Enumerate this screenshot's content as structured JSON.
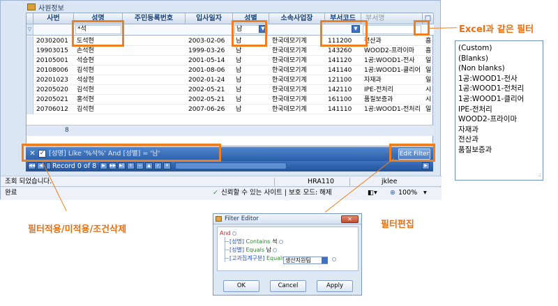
{
  "window": {
    "title": "사원정보",
    "columns": [
      "사번",
      "성명",
      "주민등록번호",
      "입사일자",
      "성별",
      "소속사업장",
      "부서코드",
      "부서명",
      "□"
    ],
    "filter_row": {
      "name_filter": "*석",
      "gender_filter": "남"
    },
    "rows": [
      {
        "id": "20302001",
        "name": "도석현",
        "join": "2003-02-06",
        "gender": "남",
        "site": "한국데모기계",
        "dept_code": "111200",
        "dept_name": "전산과",
        "extra": "흠"
      },
      {
        "id": "19903015",
        "name": "손석현",
        "join": "1999-03-26",
        "gender": "남",
        "site": "한국데모기계",
        "dept_code": "143260",
        "dept_name": "WOOD2-프라이마",
        "extra": "흠"
      },
      {
        "id": "20105001",
        "name": "석승현",
        "join": "2001-05-14",
        "gender": "남",
        "site": "한국데모기계",
        "dept_code": "141120",
        "dept_name": "1공:WOOD1-전사",
        "extra": "일"
      },
      {
        "id": "20108006",
        "name": "김석현",
        "join": "2001-08-06",
        "gender": "남",
        "site": "한국데모기계",
        "dept_code": "141140",
        "dept_name": "1공:WOOD1-클리어",
        "extra": "일"
      },
      {
        "id": "20201023",
        "name": "석상현",
        "join": "2002-01-24",
        "gender": "남",
        "site": "한국데모기계",
        "dept_code": "121100",
        "dept_name": "자재과",
        "extra": "일"
      },
      {
        "id": "20205020",
        "name": "김석현",
        "join": "2002-05-21",
        "gender": "남",
        "site": "한국데모기계",
        "dept_code": "142110",
        "dept_name": "IPE-전처리",
        "extra": "시"
      },
      {
        "id": "20205021",
        "name": "홍석현",
        "join": "2002-05-21",
        "gender": "남",
        "site": "한국데모기계",
        "dept_code": "161100",
        "dept_name": "품질보증과",
        "extra": "시"
      },
      {
        "id": "20706012",
        "name": "김석현",
        "join": "2007-06-26",
        "gender": "남",
        "site": "한국데모기계",
        "dept_code": "141110",
        "dept_name": "1공:WOOD1-전처리",
        "extra": "일"
      }
    ],
    "record_count": "8",
    "filter_text": "[성명] Like '%석%' And [성별] = '남'",
    "edit_filter_label": "Edit Filter",
    "record_nav": "Record 0 of 8",
    "status": {
      "message": "조회 되었습니다.",
      "module": "HRA110",
      "user": "jklee"
    },
    "ie_status": {
      "done": "완료",
      "zone": "신뢰할 수 있는 사이트 | 보호 모드: 해제",
      "zoom": "100%"
    }
  },
  "annotations": {
    "excel_filter": "Excel과 같은 필터",
    "filter_apply": "필터적용/미적용/조건삭제",
    "filter_edit": "필터편집"
  },
  "filter_list": [
    "(Custom)",
    "(Blanks)",
    "(Non blanks)",
    "1공:WOOD1-전사",
    "1공:WOOD1-전처리",
    "1공:WOOD1-클리어",
    "IPE-전처리",
    "WOOD2-프라이마",
    "자재과",
    "전산과",
    "품질보증과"
  ],
  "filter_editor": {
    "title": "Filter Editor",
    "root": "And",
    "conditions": [
      {
        "field": "[성명]",
        "op": "Contains",
        "value": "석"
      },
      {
        "field": "[성별]",
        "op": "Equals",
        "value": "남"
      },
      {
        "field": "[고과집계구분]",
        "op": "Equals",
        "value": "생산지원팀"
      }
    ],
    "ok": "OK",
    "cancel": "Cancel",
    "apply": "Apply"
  },
  "colors": {
    "accent": "#ef7e1f",
    "header_blue": "#15407a",
    "bar_blue": "#2a5ea8"
  }
}
